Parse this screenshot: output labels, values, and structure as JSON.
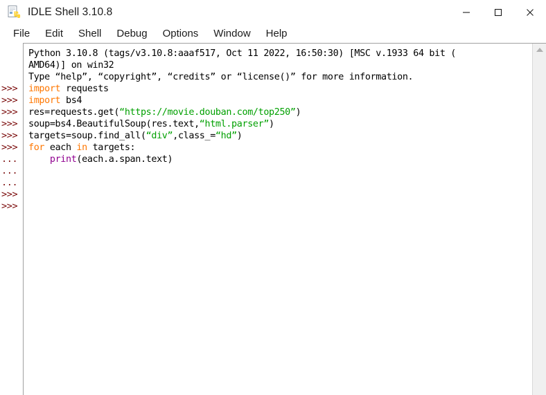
{
  "window": {
    "title": "IDLE Shell 3.10.8",
    "icon": "python-file-icon",
    "controls": {
      "minimize": "—",
      "maximize": "□",
      "close": "✕"
    }
  },
  "menubar": {
    "items": [
      {
        "label": "File"
      },
      {
        "label": "Edit"
      },
      {
        "label": "Shell"
      },
      {
        "label": "Debug"
      },
      {
        "label": "Options"
      },
      {
        "label": "Window"
      },
      {
        "label": "Help"
      }
    ]
  },
  "shell": {
    "gutter_prompts": [
      "",
      "",
      "",
      ">>>",
      ">>>",
      ">>>",
      ">>>",
      ">>>",
      ">>>",
      "...",
      "...",
      "...",
      ">>>",
      ">>>"
    ],
    "lines": [
      {
        "prompt": "",
        "tokens": [
          {
            "t": "def",
            "v": "Python 3.10.8 (tags/v3.10.8:aaaf517, Oct 11 2022, 16:50:30) [MSC v.1933 64 bit ("
          }
        ]
      },
      {
        "prompt": "",
        "tokens": [
          {
            "t": "def",
            "v": "AMD64)] on win32"
          }
        ]
      },
      {
        "prompt": "",
        "tokens": [
          {
            "t": "def",
            "v": "Type “help”, “copyright”, “credits” or “license()” for more information."
          }
        ]
      },
      {
        "prompt": ">>>",
        "tokens": [
          {
            "t": "kw",
            "v": "import"
          },
          {
            "t": "def",
            "v": " requests"
          }
        ]
      },
      {
        "prompt": ">>>",
        "tokens": [
          {
            "t": "kw",
            "v": "import"
          },
          {
            "t": "def",
            "v": " bs4"
          }
        ]
      },
      {
        "prompt": ">>>",
        "tokens": [
          {
            "t": "def",
            "v": "res=requests.get("
          },
          {
            "t": "str",
            "v": "“https://movie.douban.com/top250”"
          },
          {
            "t": "def",
            "v": ")"
          }
        ]
      },
      {
        "prompt": ">>>",
        "tokens": [
          {
            "t": "def",
            "v": "soup=bs4.BeautifulSoup(res.text,"
          },
          {
            "t": "str",
            "v": "“html.parser”"
          },
          {
            "t": "def",
            "v": ")"
          }
        ]
      },
      {
        "prompt": ">>>",
        "tokens": [
          {
            "t": "def",
            "v": "targets=soup.find_all("
          },
          {
            "t": "str",
            "v": "“div”"
          },
          {
            "t": "def",
            "v": ",class_="
          },
          {
            "t": "str",
            "v": "“hd”"
          },
          {
            "t": "def",
            "v": ")"
          }
        ]
      },
      {
        "prompt": ">>>",
        "tokens": [
          {
            "t": "kw",
            "v": "for"
          },
          {
            "t": "def",
            "v": " each "
          },
          {
            "t": "kw",
            "v": "in"
          },
          {
            "t": "def",
            "v": " targets:"
          }
        ]
      },
      {
        "prompt": "...",
        "tokens": [
          {
            "t": "def",
            "v": "    "
          },
          {
            "t": "bi",
            "v": "print"
          },
          {
            "t": "def",
            "v": "(each.a.span.text)"
          }
        ]
      },
      {
        "prompt": "...",
        "tokens": []
      },
      {
        "prompt": "...",
        "tokens": []
      },
      {
        "prompt": ">>>",
        "tokens": []
      },
      {
        "prompt": ">>>",
        "tokens": []
      }
    ]
  },
  "scrollbar": {
    "arrow_up": "scroll-up-arrow"
  },
  "colors": {
    "keyword": "#ff7700",
    "string": "#00a000",
    "builtin": "#900090",
    "prompt": "#7a0a0a",
    "text": "#000000",
    "background": "#ffffff"
  }
}
